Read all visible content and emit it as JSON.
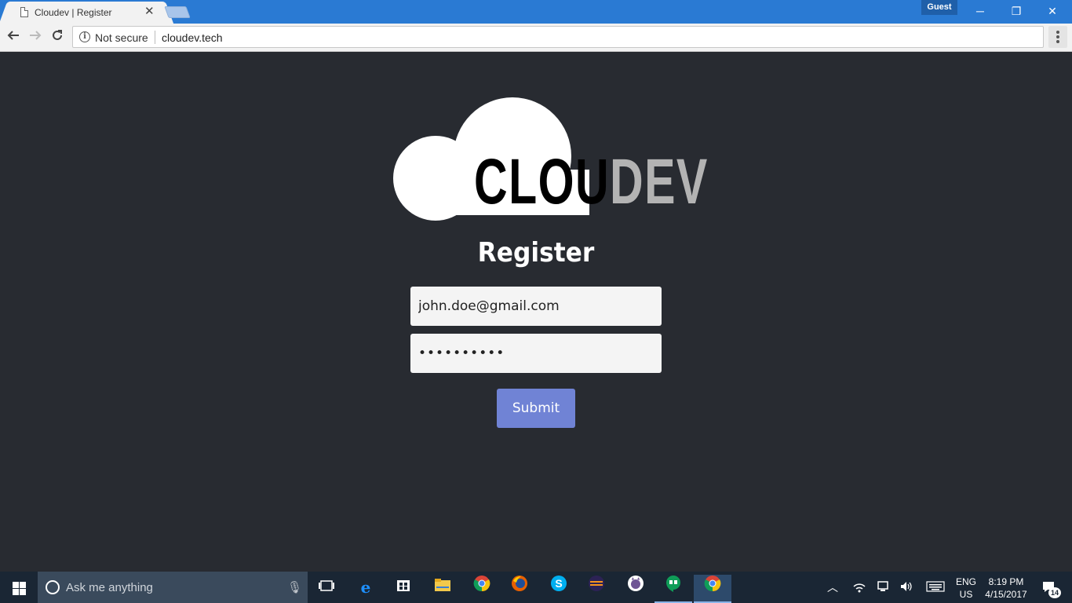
{
  "browser": {
    "tab_title": "Cloudev | Register",
    "tab_close": "✕",
    "profile_label": "Guest",
    "window_controls": {
      "minimize": "─",
      "restore": "❐",
      "close": "✕"
    },
    "security_label": "Not secure",
    "url": "cloudev.tech"
  },
  "page": {
    "logo_text_main": "CLOU",
    "logo_text_accent": "DEV",
    "heading": "Register",
    "email_value": "john.doe@gmail.com",
    "password_value": "••••••••••",
    "submit_label": "Submit"
  },
  "taskbar": {
    "search_placeholder": "Ask me anything",
    "language_top": "ENG",
    "language_bottom": "US",
    "time": "8:19 PM",
    "date": "4/15/2017",
    "notification_count": "14",
    "apps": [
      "task-view-icon",
      "edge-icon",
      "store-icon",
      "file-explorer-icon",
      "chrome-icon",
      "firefox-icon",
      "skype-icon",
      "eclipse-icon",
      "github-desktop-icon",
      "hangouts-icon",
      "chrome-icon"
    ]
  },
  "colors": {
    "page_bg": "#282b31",
    "submit_bg": "#7083d5",
    "titlebar": "#2a7ad3",
    "logo_accent": "#b3b3b3"
  }
}
